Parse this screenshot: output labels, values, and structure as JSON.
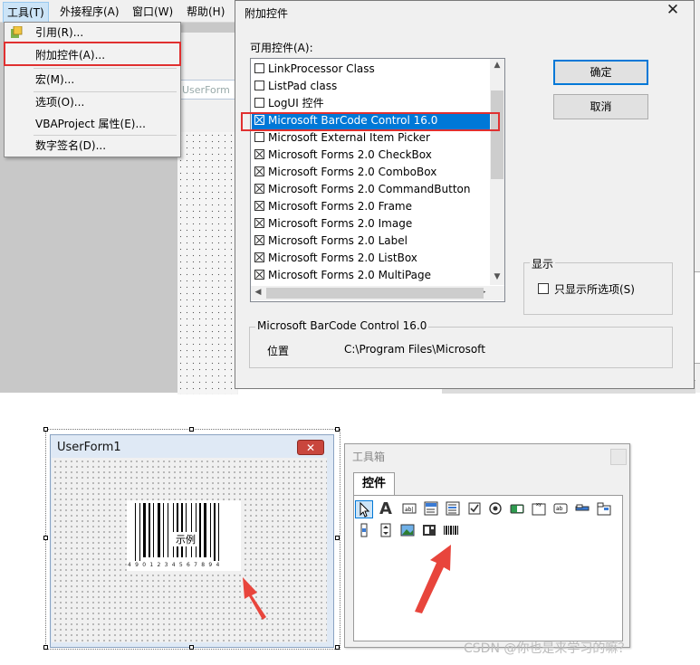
{
  "vbe": {
    "menubar": {
      "tools": "工具(T)",
      "addins": "外接程序(A)",
      "window": "窗口(W)",
      "help": "帮助(H)"
    },
    "background_form_label": "UserForm",
    "tools_menu": {
      "items": [
        "引用(R)...",
        "附加控件(A)...",
        "宏(M)...",
        "选项(O)...",
        "VBAProject 属性(E)...",
        "数字签名(D)..."
      ]
    }
  },
  "dialog": {
    "title": "附加控件",
    "close_label": "✕",
    "available_label": "可用控件(A):",
    "controls": [
      {
        "label": "LinkProcessor Class",
        "checked": false,
        "selected": false
      },
      {
        "label": "ListPad class",
        "checked": false,
        "selected": false
      },
      {
        "label": "LogUI 控件",
        "checked": false,
        "selected": false
      },
      {
        "label": "Microsoft BarCode Control 16.0",
        "checked": true,
        "selected": true
      },
      {
        "label": "Microsoft External Item Picker",
        "checked": false,
        "selected": false
      },
      {
        "label": "Microsoft Forms 2.0 CheckBox",
        "checked": true,
        "selected": false
      },
      {
        "label": "Microsoft Forms 2.0 ComboBox",
        "checked": true,
        "selected": false
      },
      {
        "label": "Microsoft Forms 2.0 CommandButton",
        "checked": true,
        "selected": false
      },
      {
        "label": "Microsoft Forms 2.0 Frame",
        "checked": true,
        "selected": false
      },
      {
        "label": "Microsoft Forms 2.0 Image",
        "checked": true,
        "selected": false
      },
      {
        "label": "Microsoft Forms 2.0 Label",
        "checked": true,
        "selected": false
      },
      {
        "label": "Microsoft Forms 2.0 ListBox",
        "checked": true,
        "selected": false
      },
      {
        "label": "Microsoft Forms 2.0 MultiPage",
        "checked": true,
        "selected": false
      }
    ],
    "ok_label": "确定",
    "cancel_label": "取消",
    "show_group_label": "显示",
    "show_selected_only_label": "只显示所选项(S)",
    "info_group_label": "Microsoft BarCode Control 16.0",
    "location_label": "位置",
    "location_value": "C:\\Program Files\\Microsoft"
  },
  "userform": {
    "title": "UserForm1",
    "close_label": "✕",
    "barcode_sample_label": "示例",
    "barcode_digits": "4 9 0 1 2 3 4 5 6 7 8 9 4"
  },
  "toolbox": {
    "title": "工具箱",
    "tab_label": "控件",
    "tools": [
      "select-objects-tool",
      "label-tool",
      "textbox-tool",
      "combobox-tool",
      "listbox-tool",
      "checkbox-tool",
      "optionbutton-tool",
      "togglebutton-tool",
      "frame-tool",
      "commandbutton-tool",
      "tabstrip-tool",
      "multipage-tool",
      "scrollbar-tool",
      "spinbutton-tool",
      "image-tool",
      "refedit-tool",
      "barcode-tool"
    ]
  },
  "watermark": "CSDN @你也是来学习的嘛？",
  "colors": {
    "highlight_red": "#e03030",
    "selection_blue": "#0078d7",
    "arrow_red": "#e8453c"
  }
}
